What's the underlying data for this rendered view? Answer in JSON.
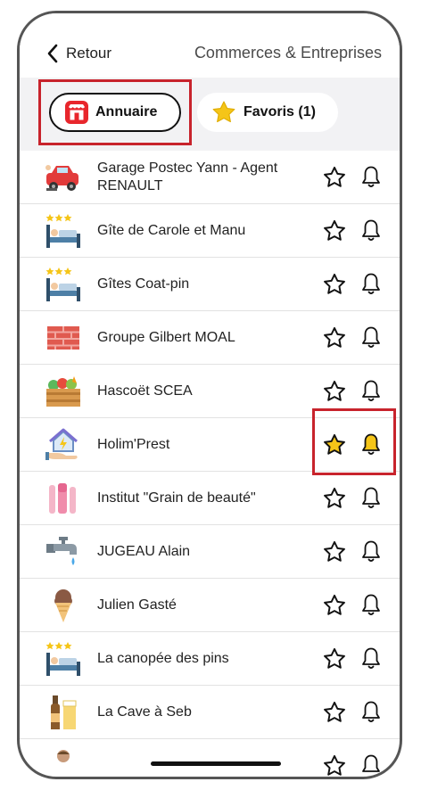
{
  "header": {
    "back_label": "Retour",
    "title": "Commerces & Entreprises"
  },
  "tabs": [
    {
      "label": "Annuaire",
      "icon": "shop-icon",
      "selected": true
    },
    {
      "label": "Favoris (1)",
      "icon": "star-icon",
      "selected": false
    }
  ],
  "colors": {
    "accent_red": "#c8232c",
    "star_gold": "#f5c518",
    "tab_bar_bg": "#f2f2f4"
  },
  "entries": [
    {
      "name": "Garage Postec Yann - Agent RENAULT",
      "icon": "car-repair-icon",
      "favorite": false,
      "notify": false
    },
    {
      "name": "Gîte de Carole et Manu",
      "icon": "hotel-bed-icon",
      "favorite": false,
      "notify": false
    },
    {
      "name": "Gîtes Coat-pin",
      "icon": "hotel-bed-icon",
      "favorite": false,
      "notify": false
    },
    {
      "name": "Groupe Gilbert MOAL",
      "icon": "brick-wall-icon",
      "favorite": false,
      "notify": false
    },
    {
      "name": "Hascoët SCEA",
      "icon": "vegetable-crate-icon",
      "favorite": false,
      "notify": false
    },
    {
      "name": "Holim'Prest",
      "icon": "house-hand-icon",
      "favorite": true,
      "notify": true
    },
    {
      "name": "Institut \"Grain de beauté\"",
      "icon": "beauty-brushes-icon",
      "favorite": false,
      "notify": false
    },
    {
      "name": "JUGEAU Alain",
      "icon": "water-tap-icon",
      "favorite": false,
      "notify": false
    },
    {
      "name": "Julien Gasté",
      "icon": "ice-cream-icon",
      "favorite": false,
      "notify": false
    },
    {
      "name": "La canopée des pins",
      "icon": "hotel-bed-icon",
      "favorite": false,
      "notify": false
    },
    {
      "name": "La Cave à Seb",
      "icon": "beer-bottle-icon",
      "favorite": false,
      "notify": false
    }
  ]
}
